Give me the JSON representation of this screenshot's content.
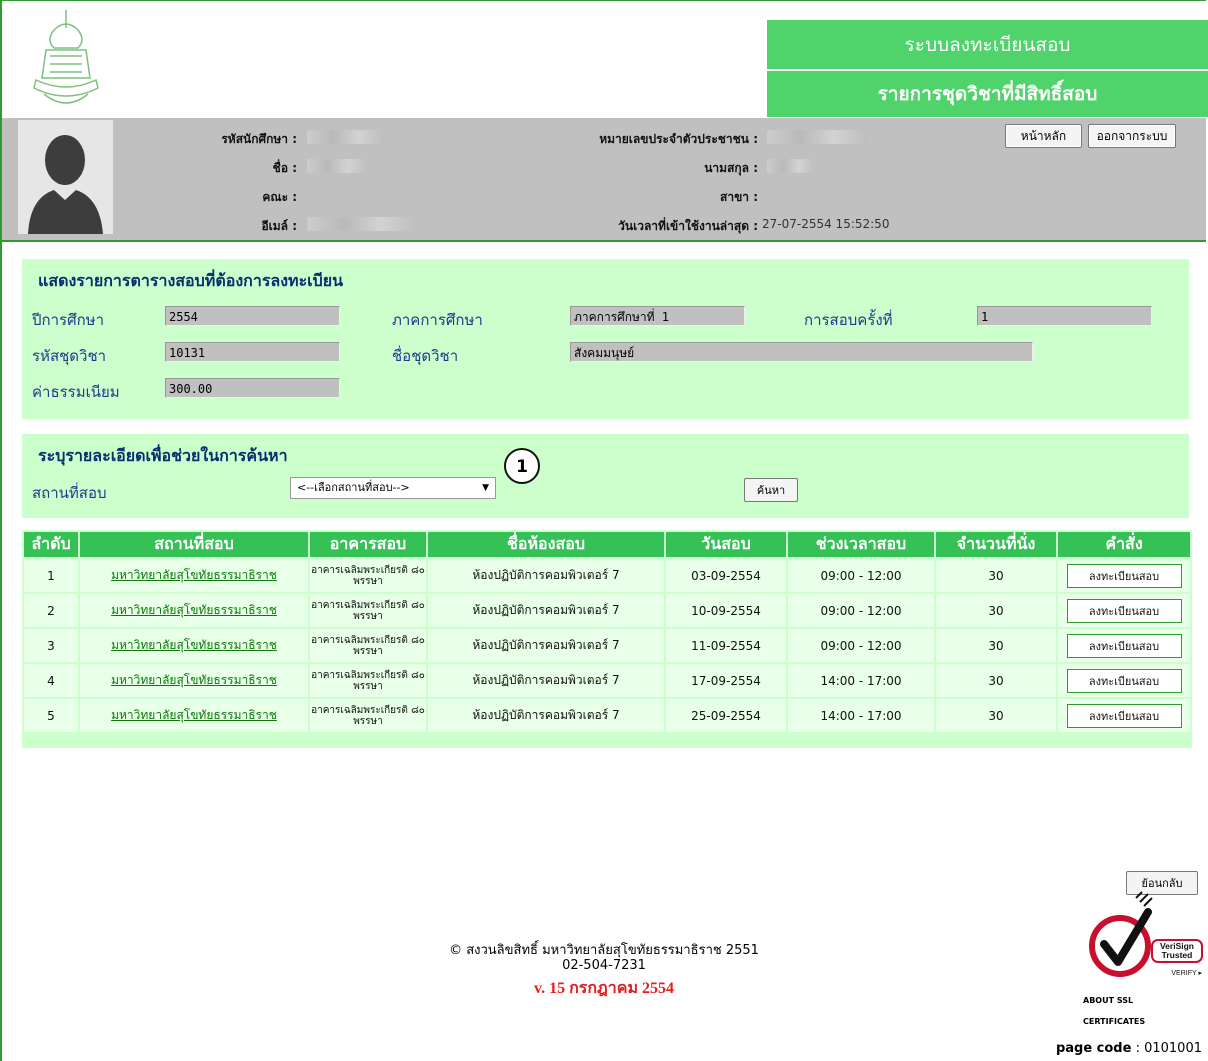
{
  "header": {
    "system_title": "ระบบลงทะเบียนสอบ",
    "page_title": "รายการชุดวิชาที่มีสิทธิ์สอบ"
  },
  "user": {
    "student_id_label": "รหัสนักศึกษา :",
    "name_label": "ชื่อ :",
    "faculty_label": "คณะ :",
    "email_label": "อีเมล์ :",
    "citizen_id_label": "หมายเลขประจำตัวประชาชน :",
    "surname_label": "นามสกุล :",
    "major_label": "สาขา :",
    "last_login_label": "วันเวลาที่เข้าใช้งานล่าสุด :",
    "last_login_value": "27-07-2554 15:52:50",
    "home_button": "หน้าหลัก",
    "logout_button": "ออกจากระบบ"
  },
  "exam_info": {
    "title": "แสดงรายการตารางสอบที่ต้องการลงทะเบียน",
    "year_label": "ปีการศึกษา",
    "year_value": "2554",
    "semester_label": "ภาคการศึกษา",
    "semester_value": "ภาคการศึกษาที่ 1",
    "round_label": "การสอบครั้งที่",
    "round_value": "1",
    "course_code_label": "รหัสชุดวิชา",
    "course_code_value": "10131",
    "course_name_label": "ชื่อชุดวิชา",
    "course_name_value": "สังคมมนุษย์",
    "fee_label": "ค่าธรรมเนียม",
    "fee_value": "300.00"
  },
  "search": {
    "title": "ระบุรายละเอียดเพื่อช่วยในการค้นหา",
    "place_label": "สถานที่สอบ",
    "place_selected": "<--เลือกสถานที่สอบ-->",
    "marker": "1",
    "search_button": "ค้นหา"
  },
  "table": {
    "headers": [
      "ลำดับ",
      "สถานที่สอบ",
      "อาคารสอบ",
      "ชื่อห้องสอบ",
      "วันสอบ",
      "ช่วงเวลาสอบ",
      "จำนวนที่นั่ง",
      "คำสั่ง"
    ],
    "rows": [
      {
        "no": "1",
        "place": "มหาวิทยาลัยสุโขทัยธรรมาธิราช",
        "building": "อาคารเฉลิมพระเกียรติ ๘๐ พรรษา",
        "room": "ห้องปฏิบัติการคอมพิวเตอร์ 7",
        "date": "03-09-2554",
        "time": "09:00 - 12:00",
        "seats": "30",
        "action": "ลงทะเบียนสอบ"
      },
      {
        "no": "2",
        "place": "มหาวิทยาลัยสุโขทัยธรรมาธิราช",
        "building": "อาคารเฉลิมพระเกียรติ ๘๐ พรรษา",
        "room": "ห้องปฏิบัติการคอมพิวเตอร์ 7",
        "date": "10-09-2554",
        "time": "09:00 - 12:00",
        "seats": "30",
        "action": "ลงทะเบียนสอบ"
      },
      {
        "no": "3",
        "place": "มหาวิทยาลัยสุโขทัยธรรมาธิราช",
        "building": "อาคารเฉลิมพระเกียรติ ๘๐ พรรษา",
        "room": "ห้องปฏิบัติการคอมพิวเตอร์ 7",
        "date": "11-09-2554",
        "time": "09:00 - 12:00",
        "seats": "30",
        "action": "ลงทะเบียนสอบ"
      },
      {
        "no": "4",
        "place": "มหาวิทยาลัยสุโขทัยธรรมาธิราช",
        "building": "อาคารเฉลิมพระเกียรติ ๘๐ พรรษา",
        "room": "ห้องปฏิบัติการคอมพิวเตอร์ 7",
        "date": "17-09-2554",
        "time": "14:00 - 17:00",
        "seats": "30",
        "action": "ลงทะเบียนสอบ"
      },
      {
        "no": "5",
        "place": "มหาวิทยาลัยสุโขทัยธรรมาธิราช",
        "building": "อาคารเฉลิมพระเกียรติ ๘๐ พรรษา",
        "room": "ห้องปฏิบัติการคอมพิวเตอร์ 7",
        "date": "25-09-2554",
        "time": "14:00 - 17:00",
        "seats": "30",
        "action": "ลงทะเบียนสอบ"
      }
    ]
  },
  "footer": {
    "back_button": "ย้อนกลับ",
    "copyright": "© สงวนลิขสิทธิ์ มหาวิทยาลัยสุโขทัยธรรมาธิราช 2551",
    "phone": "02-504-7231",
    "version": "v. 15 กรกฎาคม 2554",
    "ssl_line1": "ABOUT SSL",
    "ssl_line2": "CERTIFICATES",
    "page_code_label": "page code",
    "page_code_value": ": 0101001",
    "verisign_text": "VeriSign Trusted",
    "verify_text": "VERIFY ▸"
  },
  "colors": {
    "accent_green": "#4fd36a",
    "header_green": "#36c157",
    "panel_green": "#ccffcc",
    "title_blue": "#05306e",
    "version_red": "#e02020"
  }
}
